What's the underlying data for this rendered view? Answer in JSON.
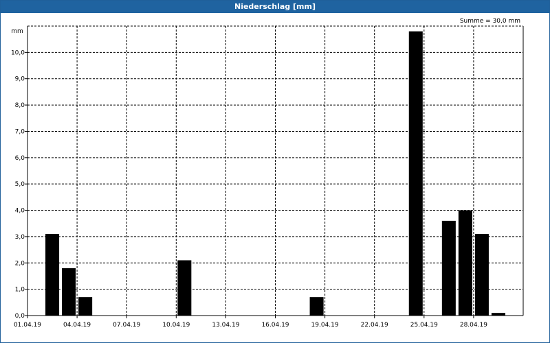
{
  "window": {
    "title": "Niederschlag [mm]"
  },
  "chart_data": {
    "type": "bar",
    "title": "Niederschlag [mm]",
    "annotation": "Summe = 30,0 mm",
    "ylabel": "mm",
    "ylim": [
      0,
      11
    ],
    "yticks": [
      "0,0",
      "1,0",
      "2,0",
      "3,0",
      "4,0",
      "5,0",
      "6,0",
      "7,0",
      "8,0",
      "9,0",
      "10,0"
    ],
    "xtick_labels": [
      "01.04.19",
      "04.04.19",
      "07.04.19",
      "10.04.19",
      "13.04.19",
      "16.04.19",
      "19.04.19",
      "22.04.19",
      "25.04.19",
      "28.04.19"
    ],
    "grid": true,
    "categories": [
      "01.04.19",
      "02.04.19",
      "03.04.19",
      "04.04.19",
      "05.04.19",
      "06.04.19",
      "07.04.19",
      "08.04.19",
      "09.04.19",
      "10.04.19",
      "11.04.19",
      "12.04.19",
      "13.04.19",
      "14.04.19",
      "15.04.19",
      "16.04.19",
      "17.04.19",
      "18.04.19",
      "19.04.19",
      "20.04.19",
      "21.04.19",
      "22.04.19",
      "23.04.19",
      "24.04.19",
      "25.04.19",
      "26.04.19",
      "27.04.19",
      "28.04.19",
      "29.04.19",
      "30.04.19"
    ],
    "values": [
      0,
      3.1,
      1.8,
      0.7,
      0,
      0,
      0,
      0,
      0,
      2.1,
      0,
      0,
      0,
      0,
      0,
      0,
      0,
      0.7,
      0,
      0,
      0,
      0,
      0,
      10.8,
      0,
      3.6,
      4.0,
      3.1,
      0.1,
      0
    ]
  }
}
